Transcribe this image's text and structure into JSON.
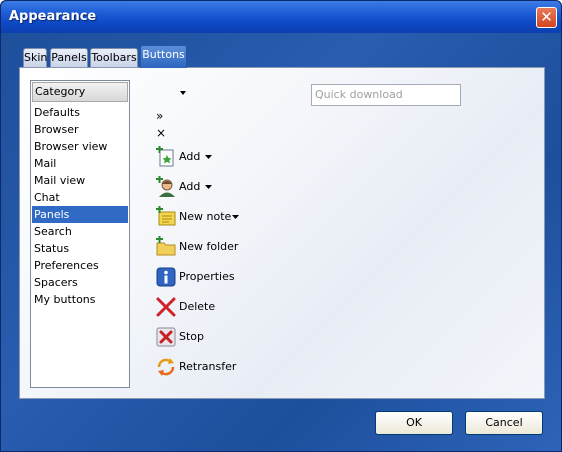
{
  "window": {
    "title": "Appearance",
    "close_glyph": "✕"
  },
  "tabs": [
    {
      "label": "Skin",
      "active": false
    },
    {
      "label": "Panels",
      "active": false
    },
    {
      "label": "Toolbars",
      "active": false
    },
    {
      "label": "Buttons",
      "active": true
    }
  ],
  "category_list": {
    "header": "Category",
    "items": [
      "Defaults",
      "Browser",
      "Browser view",
      "Mail",
      "Mail view",
      "Chat",
      "Panels",
      "Search",
      "Status",
      "Preferences",
      "Spacers",
      "My buttons"
    ],
    "selected": "Panels"
  },
  "quick_download": {
    "placeholder": "Quick download"
  },
  "glyphs": {
    "chevron": "»",
    "close": "×"
  },
  "buttons": [
    {
      "label": "Add",
      "icon": "add-page-icon",
      "dropdown": true
    },
    {
      "label": "Add",
      "icon": "add-contact-icon",
      "dropdown": true
    },
    {
      "label": "New note",
      "icon": "new-note-icon",
      "dropdown": true
    },
    {
      "label": "New folder",
      "icon": "new-folder-icon",
      "dropdown": false
    },
    {
      "label": "Properties",
      "icon": "info-icon",
      "dropdown": false
    },
    {
      "label": "Delete",
      "icon": "delete-icon",
      "dropdown": false
    },
    {
      "label": "Stop",
      "icon": "stop-icon",
      "dropdown": false
    },
    {
      "label": "Retransfer",
      "icon": "retransfer-icon",
      "dropdown": false
    }
  ],
  "dialog": {
    "ok_label": "OK",
    "cancel_label": "Cancel"
  },
  "colors": {
    "title_bar": "#0e48c4",
    "selection": "#316ac5",
    "close_button": "#d2451e"
  }
}
